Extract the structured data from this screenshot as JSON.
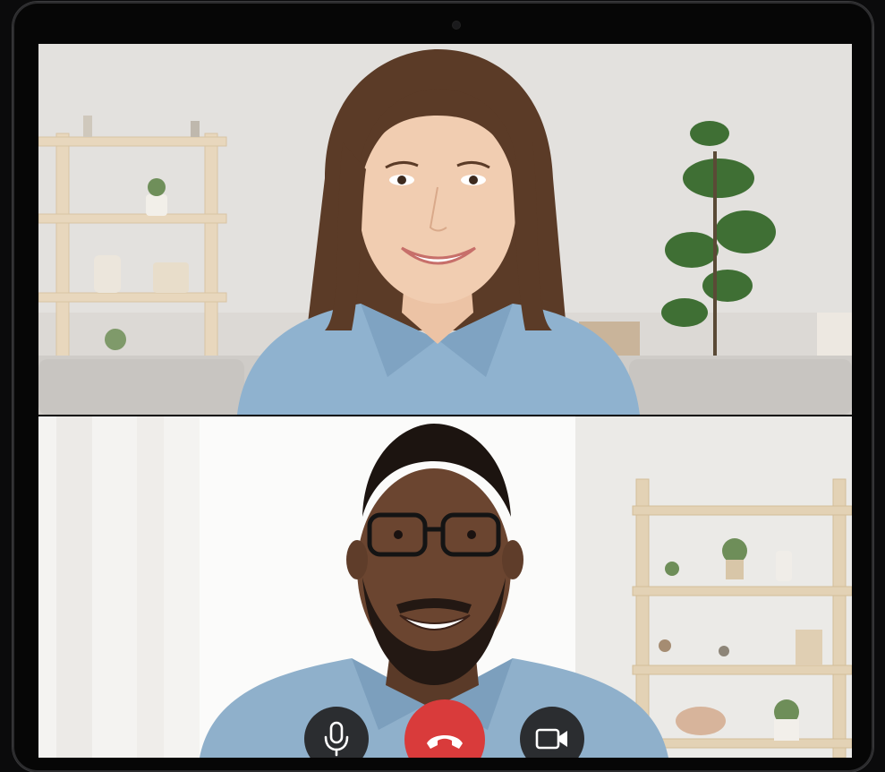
{
  "call": {
    "participants": [
      {
        "role": "remote",
        "position": "top"
      },
      {
        "role": "remote",
        "position": "bottom"
      }
    ]
  },
  "controls": {
    "mic": {
      "icon": "microphone-icon",
      "color": "#2b2d30"
    },
    "end_call": {
      "icon": "phone-hangup-icon",
      "color": "#d93b3b"
    },
    "camera": {
      "icon": "video-camera-icon",
      "color": "#2b2d30"
    }
  }
}
